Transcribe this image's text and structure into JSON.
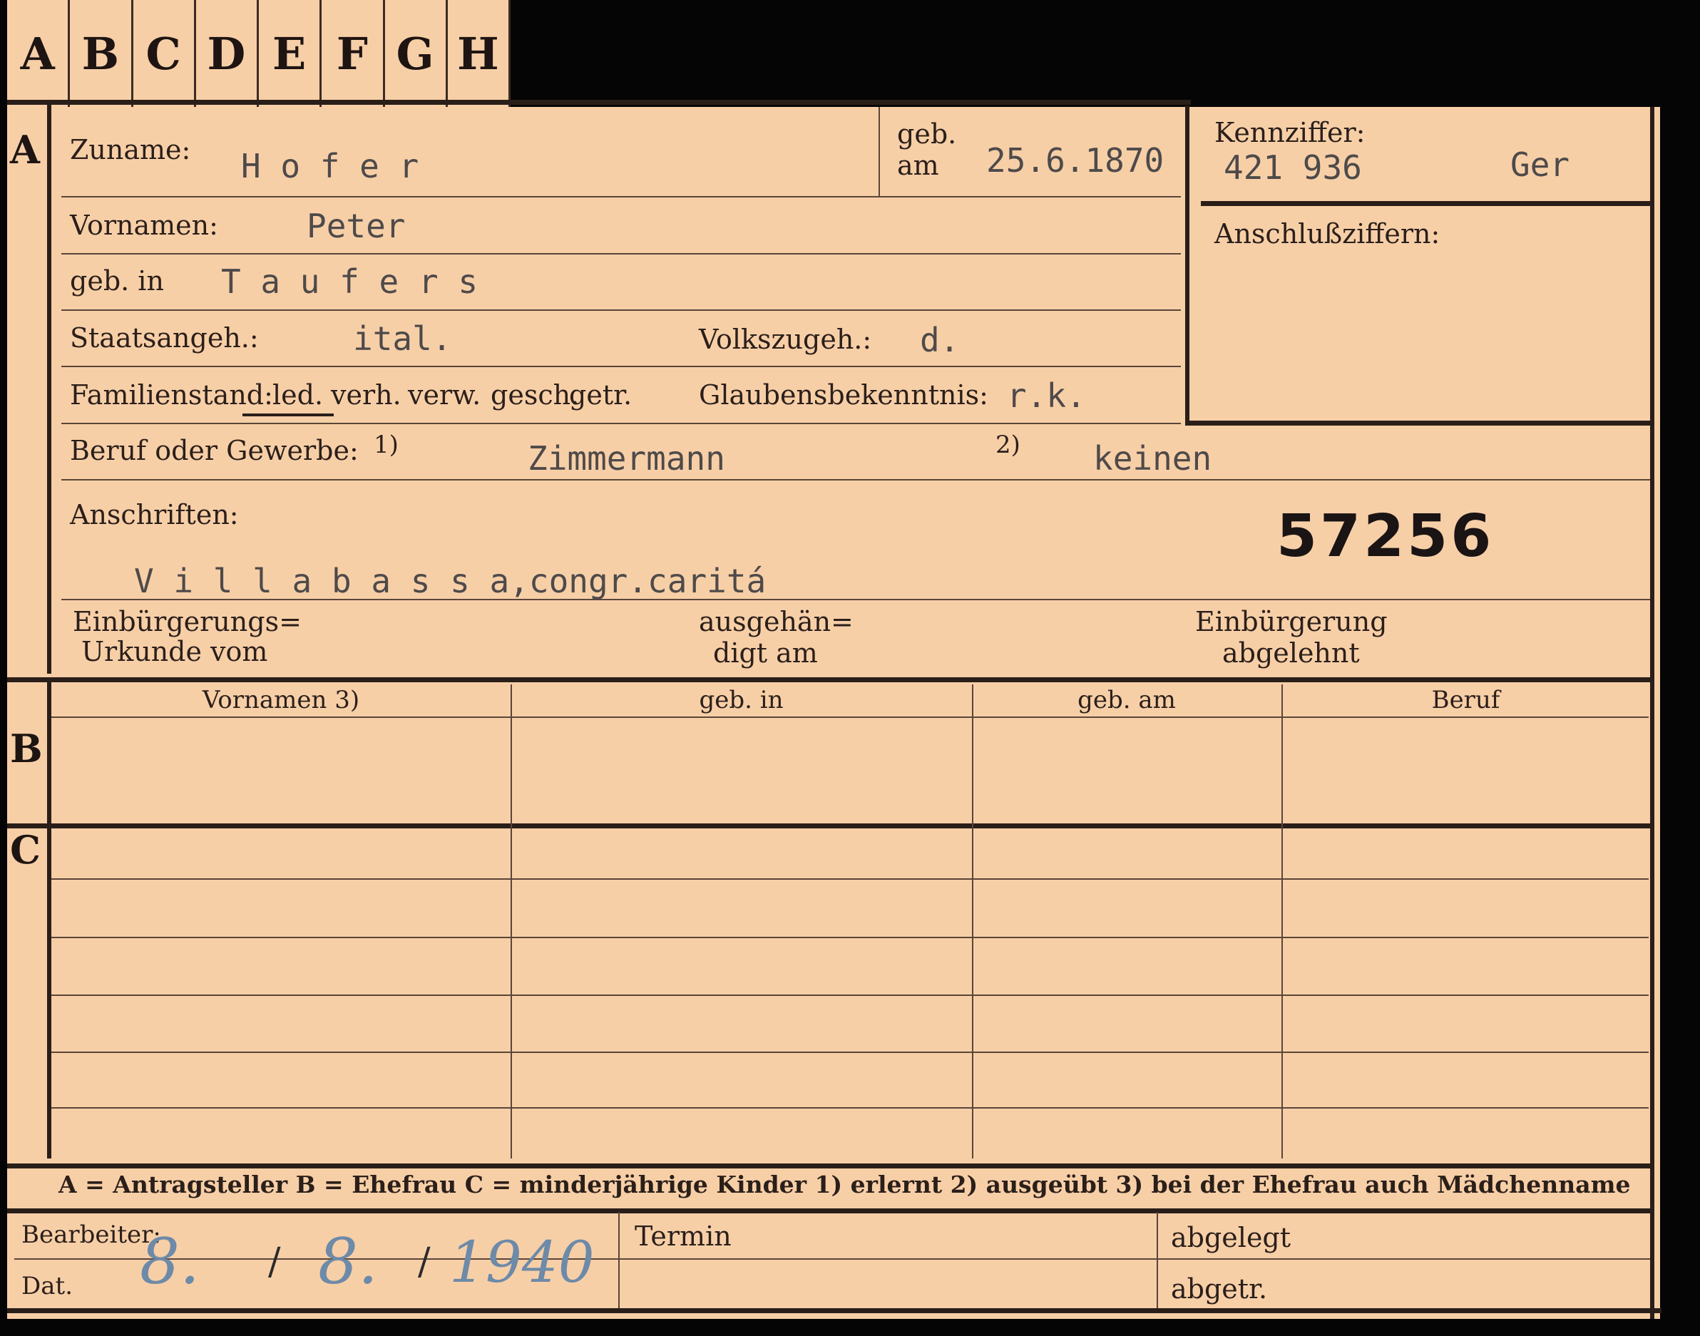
{
  "tabs": [
    "A",
    "B",
    "C",
    "D",
    "E",
    "F",
    "G",
    "H"
  ],
  "sections": {
    "a": "A",
    "b": "B",
    "c": "C"
  },
  "fields": {
    "zuname": {
      "label": "Zuname:",
      "value": "H o f e r"
    },
    "geb_am": {
      "label_line1": "geb.",
      "label_line2": "am",
      "value": "25.6.1870"
    },
    "kennziffer": {
      "label": "Kennziffer:",
      "value": "421 936",
      "suffix": "Ger"
    },
    "anschlussziffern": {
      "label": "Anschlußziffern:"
    },
    "vornamen": {
      "label": "Vornamen:",
      "value": "Peter"
    },
    "geb_in": {
      "label": "geb. in",
      "value": "T a u f e r s"
    },
    "staatsangeh": {
      "label": "Staatsangeh.:",
      "value": "ital."
    },
    "volkszugeh": {
      "label": "Volkszugeh.:",
      "value": "d."
    },
    "familienstand": {
      "label": "Familienstand:",
      "options": [
        "led.",
        "verh.",
        "verw.",
        "gesch.",
        "getr."
      ],
      "selected": "led."
    },
    "glaubensbekenntnis": {
      "label": "Glaubensbekenntnis:",
      "value": "r.k."
    },
    "beruf": {
      "label": "Beruf oder Gewerbe:",
      "marker1": "1)",
      "value1": "Zimmermann",
      "marker2": "2)",
      "value2": "keinen"
    },
    "anschriften": {
      "label": "Anschriften:",
      "value": "V i l l a b a s s a,congr.caritá"
    },
    "card_number": "57256",
    "einbuergerung_urkunde": {
      "line1": "Einbürgerungs=",
      "line2": "Urkunde vom"
    },
    "ausgehaendigt": {
      "line1": "ausgehän=",
      "line2": "digt am"
    },
    "einbuergerung_abgelehnt": {
      "line1": "Einbürgerung",
      "line2": "abgelehnt"
    }
  },
  "table_columns": [
    "Vornamen 3)",
    "geb. in",
    "geb. am",
    "Beruf"
  ],
  "legend": "A = Antragsteller    B = Ehefrau    C = minderjährige Kinder    1) erlernt    2) ausgeübt    3) bei der Ehefrau auch Mädchenname",
  "footer": {
    "bearbeiter": "Bearbeiter:",
    "dat": "Dat.",
    "termin": "Termin",
    "abgelegt": "abgelegt",
    "abgetr": "abgetr.",
    "date_day": "8.",
    "date_month": "8.",
    "date_year": "1940",
    "date_sep": "/"
  },
  "colors": {
    "paper": "#f7cfa7",
    "ink": "#2b1f1a",
    "typewriter": "#4e4a4a",
    "pencil": "#6d8aa8"
  }
}
